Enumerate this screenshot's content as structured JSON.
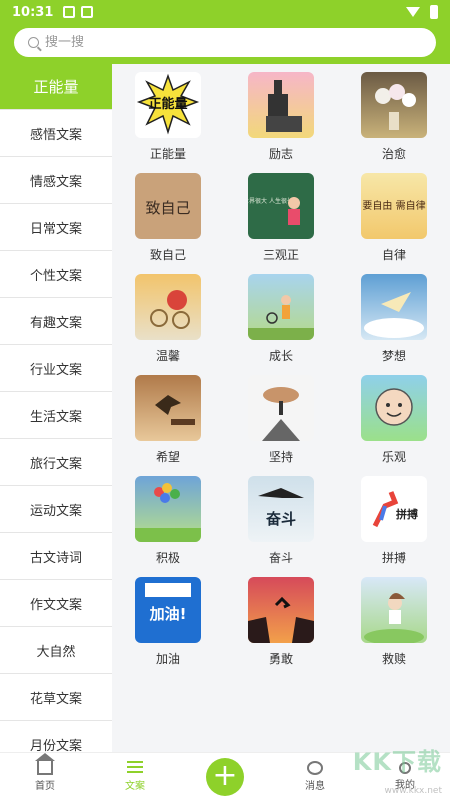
{
  "status": {
    "time": "10:31"
  },
  "search": {
    "placeholder": "搜一搜"
  },
  "sidebar": {
    "items": [
      {
        "label": "正能量"
      },
      {
        "label": "感悟文案"
      },
      {
        "label": "情感文案"
      },
      {
        "label": "日常文案"
      },
      {
        "label": "个性文案"
      },
      {
        "label": "有趣文案"
      },
      {
        "label": "行业文案"
      },
      {
        "label": "生活文案"
      },
      {
        "label": "旅行文案"
      },
      {
        "label": "运动文案"
      },
      {
        "label": "古文诗词"
      },
      {
        "label": "作文文案"
      },
      {
        "label": "大自然"
      },
      {
        "label": "花草文案"
      },
      {
        "label": "月份文案"
      }
    ]
  },
  "grid": {
    "items": [
      {
        "label": "正能量",
        "thumb_text": "正能量"
      },
      {
        "label": "励志",
        "thumb_text": ""
      },
      {
        "label": "治愈",
        "thumb_text": ""
      },
      {
        "label": "致自己",
        "thumb_text": "致自己"
      },
      {
        "label": "三观正",
        "thumb_text": "世界很大 人生很长"
      },
      {
        "label": "自律",
        "thumb_text": "要自由 需自律"
      },
      {
        "label": "温馨",
        "thumb_text": ""
      },
      {
        "label": "成长",
        "thumb_text": ""
      },
      {
        "label": "梦想",
        "thumb_text": ""
      },
      {
        "label": "希望",
        "thumb_text": ""
      },
      {
        "label": "坚持",
        "thumb_text": ""
      },
      {
        "label": "乐观",
        "thumb_text": ""
      },
      {
        "label": "积极",
        "thumb_text": ""
      },
      {
        "label": "奋斗",
        "thumb_text": "奋斗"
      },
      {
        "label": "拼搏",
        "thumb_text": "拼搏"
      },
      {
        "label": "加油",
        "thumb_text": "加油!"
      },
      {
        "label": "勇敢",
        "thumb_text": ""
      },
      {
        "label": "救赎",
        "thumb_text": ""
      }
    ]
  },
  "bottom": {
    "tabs": [
      {
        "label": "首页"
      },
      {
        "label": "文案"
      },
      {
        "label": "+"
      },
      {
        "label": "消息"
      },
      {
        "label": "我的"
      }
    ]
  },
  "watermark": {
    "main": "KK下载",
    "sub": "www.kkx.net"
  },
  "colors": {
    "accent": "#8ed12a",
    "background": "#f4f5f7"
  }
}
